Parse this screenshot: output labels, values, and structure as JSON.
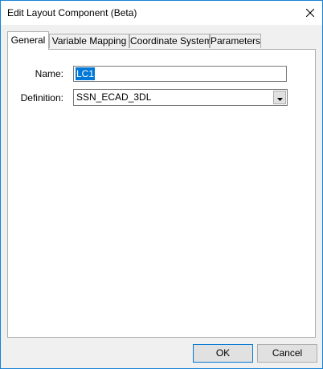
{
  "window": {
    "title": "Edit Layout Component (Beta)"
  },
  "tabs": [
    {
      "label": "General",
      "active": true
    },
    {
      "label": "Variable Mapping",
      "active": false
    },
    {
      "label": "Coordinate System",
      "active": false
    },
    {
      "label": "Parameters",
      "active": false
    }
  ],
  "general": {
    "name_label": "Name:",
    "name_value": "LC1",
    "definition_label": "Definition:",
    "definition_value": "SSN_ECAD_3DL"
  },
  "footer": {
    "ok_label": "OK",
    "cancel_label": "Cancel"
  },
  "colors": {
    "accent": "#0078d7",
    "window_border": "#1883d7",
    "dialog_bg": "#f0f0f0"
  },
  "icons": {
    "close": "close-icon",
    "dropdown": "chevron-down-icon"
  }
}
